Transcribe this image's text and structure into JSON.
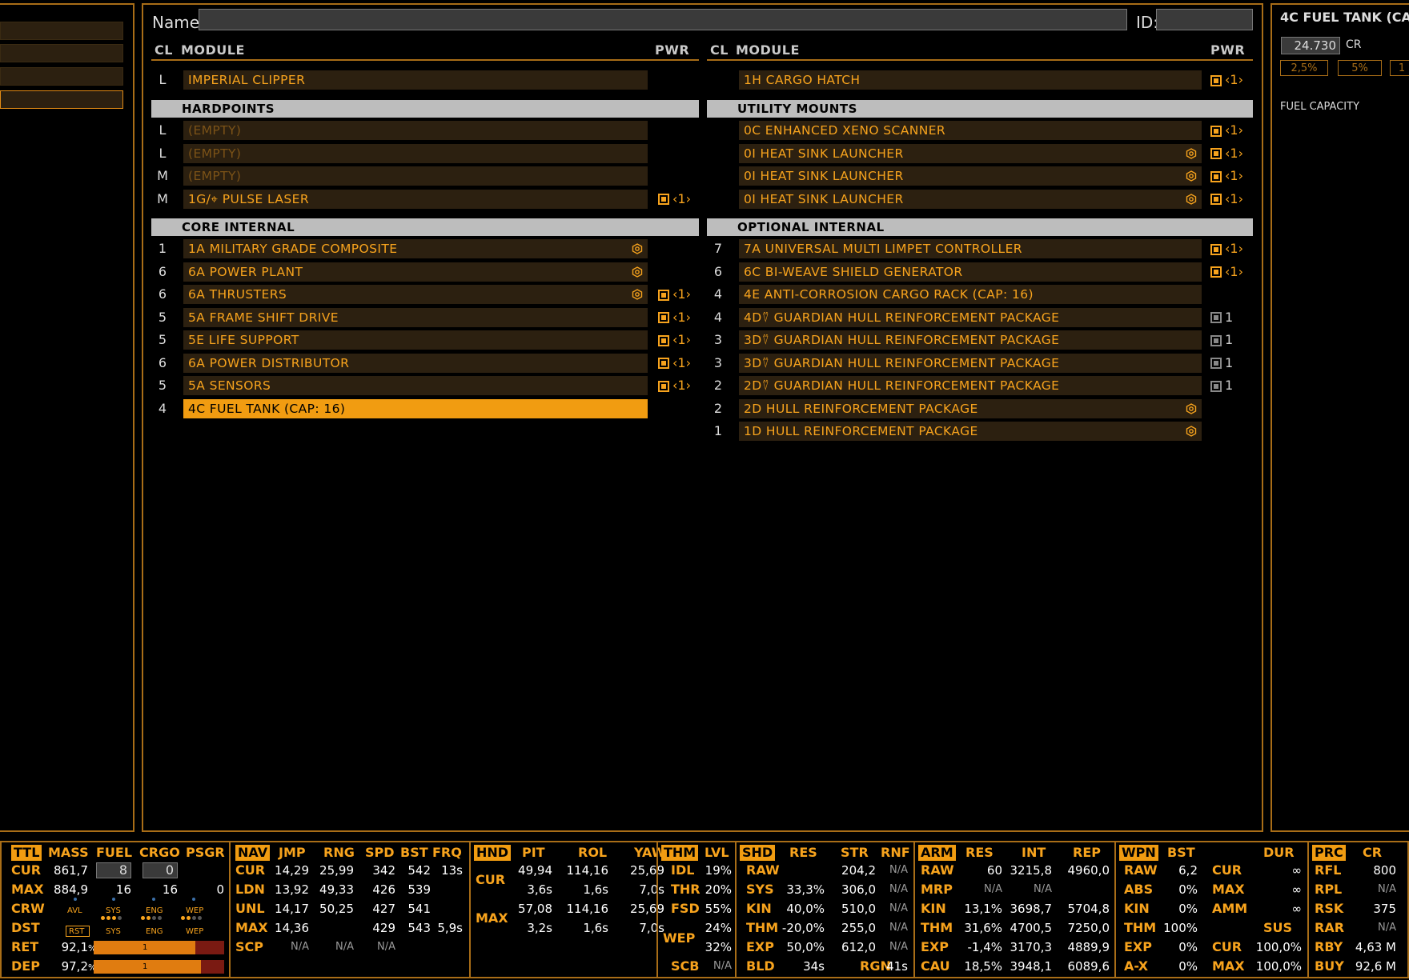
{
  "name_bar": {
    "name_label": "Name:",
    "name_value": "",
    "id_label": "ID:",
    "id_value": ""
  },
  "columns": {
    "cl": "CL",
    "module": "MODULE",
    "pwr": "PWR"
  },
  "left": {
    "hull": {
      "class": "L",
      "name": "IMPERIAL CLIPPER"
    },
    "hardpoints_title": "HARDPOINTS",
    "hardpoints": [
      {
        "class": "L",
        "name": "(EMPTY)",
        "empty": true
      },
      {
        "class": "L",
        "name": "(EMPTY)",
        "empty": true
      },
      {
        "class": "M",
        "name": "(EMPTY)",
        "empty": true
      },
      {
        "class": "M",
        "name": "1G/⌖ PULSE LASER",
        "pwr": true,
        "prio": "‹1›"
      }
    ],
    "core_title": "CORE INTERNAL",
    "core": [
      {
        "class": "1",
        "name": "1A MILITARY GRADE COMPOSITE",
        "eng": true
      },
      {
        "class": "6",
        "name": "6A POWER PLANT",
        "eng": true
      },
      {
        "class": "6",
        "name": "6A THRUSTERS",
        "eng": true,
        "pwr": true,
        "prio": "‹1›"
      },
      {
        "class": "5",
        "name": "5A FRAME SHIFT DRIVE",
        "pwr": true,
        "prio": "‹1›"
      },
      {
        "class": "5",
        "name": "5E LIFE SUPPORT",
        "pwr": true,
        "prio": "‹1›"
      },
      {
        "class": "6",
        "name": "6A POWER DISTRIBUTOR",
        "pwr": true,
        "prio": "‹1›"
      },
      {
        "class": "5",
        "name": "5A SENSORS",
        "pwr": true,
        "prio": "‹1›"
      },
      {
        "class": "4",
        "name": "4C FUEL TANK (CAP: 16)",
        "selected": true
      }
    ]
  },
  "right": {
    "cargo_hatch": {
      "name": "1H CARGO HATCH",
      "pwr": true,
      "prio": "‹1›"
    },
    "utility_title": "UTILITY MOUNTS",
    "utility": [
      {
        "name": "0C ENHANCED XENO SCANNER",
        "pwr": true,
        "prio": "‹1›"
      },
      {
        "name": "0I HEAT SINK LAUNCHER",
        "eng": true,
        "pwr": true,
        "prio": "‹1›"
      },
      {
        "name": "0I HEAT SINK LAUNCHER",
        "eng": true,
        "pwr": true,
        "prio": "‹1›"
      },
      {
        "name": "0I HEAT SINK LAUNCHER",
        "eng": true,
        "pwr": true,
        "prio": "‹1›"
      }
    ],
    "optional_title": "OPTIONAL INTERNAL",
    "optional": [
      {
        "class": "7",
        "name": "7A UNIVERSAL MULTI LIMPET CONTROLLER",
        "pwr": true,
        "prio": "‹1›"
      },
      {
        "class": "6",
        "name": "6C BI-WEAVE SHIELD GENERATOR",
        "pwr": true,
        "prio": "‹1›"
      },
      {
        "class": "4",
        "name": "4E ANTI-CORROSION CARGO RACK (CAP: 16)"
      },
      {
        "class": "4",
        "name": "4D⍢ GUARDIAN HULL REINFORCEMENT PACKAGE",
        "pwr_off": true,
        "prio": "1"
      },
      {
        "class": "3",
        "name": "3D⍢ GUARDIAN HULL REINFORCEMENT PACKAGE",
        "pwr_off": true,
        "prio": "1"
      },
      {
        "class": "3",
        "name": "3D⍢ GUARDIAN HULL REINFORCEMENT PACKAGE",
        "pwr_off": true,
        "prio": "1"
      },
      {
        "class": "2",
        "name": "2D⍢ GUARDIAN HULL REINFORCEMENT PACKAGE",
        "pwr_off": true,
        "prio": "1"
      },
      {
        "class": "2",
        "name": "2D HULL REINFORCEMENT PACKAGE",
        "eng": true
      },
      {
        "class": "1",
        "name": "1D HULL REINFORCEMENT PACKAGE",
        "eng": true
      }
    ]
  },
  "side_panel": {
    "title": "4C FUEL TANK (CA",
    "cost": "24.730",
    "cost_unit": "CR",
    "discounts": [
      "2,5%",
      "5%",
      "1"
    ],
    "fuel_capacity_label": "FUEL CAPACITY"
  },
  "stats": {
    "ttl": {
      "headers": [
        "TTL",
        "MASS",
        "FUEL",
        "CRGO",
        "PSGR"
      ],
      "cur": {
        "label": "CUR",
        "mass": "861,7",
        "fuel": "8",
        "crgo": "0"
      },
      "max": {
        "label": "MAX",
        "mass": "884,9",
        "fuel": "16",
        "crgo": "16",
        "psgr": "0"
      },
      "crw": "CRW",
      "dst": "DST",
      "ret": "RET",
      "dep": "DEP",
      "ret_val": "92,1",
      "dep_val": "97,2",
      "pct": "%",
      "avl": "AVL",
      "sys": "SYS",
      "eng": "ENG",
      "wep": "WEP",
      "rst": "RST",
      "ret_fill": 0.921,
      "dep_fill": 0.972,
      "bar_mark": "1"
    },
    "nav": {
      "headers": [
        "NAV",
        "JMP",
        "RNG",
        "SPD",
        "BST",
        "FRQ"
      ],
      "rows": [
        [
          "CUR",
          "14,29",
          "25,99",
          "342",
          "542",
          "13s"
        ],
        [
          "LDN",
          "13,92",
          "49,33",
          "426",
          "539",
          ""
        ],
        [
          "UNL",
          "14,17",
          "50,25",
          "427",
          "541",
          ""
        ],
        [
          "MAX",
          "14,36",
          "",
          "429",
          "543",
          "5,9s"
        ],
        [
          "SCP",
          "N/A",
          "N/A",
          "N/A",
          "",
          ""
        ]
      ]
    },
    "hnd": {
      "headers": [
        "HND",
        "PIT",
        "ROL",
        "YAW"
      ],
      "cur_label": "CUR",
      "max_label": "MAX",
      "rows": [
        [
          "49,94",
          "114,16",
          "25,69"
        ],
        [
          "3,6s",
          "1,6s",
          "7,0s"
        ],
        [
          "57,08",
          "114,16",
          "25,69"
        ],
        [
          "3,2s",
          "1,6s",
          "7,0s"
        ]
      ]
    },
    "thm": {
      "headers": [
        "THM",
        "LVL"
      ],
      "rows": [
        [
          "IDL",
          "19%"
        ],
        [
          "THR",
          "20%"
        ],
        [
          "FSD",
          "55%"
        ],
        [
          "WEP",
          "24%"
        ],
        [
          "",
          "32%"
        ],
        [
          "SCB",
          "N/A"
        ]
      ]
    },
    "shd": {
      "headers": [
        "SHD",
        "RES",
        "STR",
        "RNF"
      ],
      "rows": [
        [
          "RAW",
          "",
          "204,2",
          "N/A"
        ],
        [
          "SYS",
          "33,3%",
          "306,0",
          "N/A"
        ],
        [
          "KIN",
          "40,0%",
          "510,0",
          "N/A"
        ],
        [
          "THM",
          "-20,0%",
          "255,0",
          "N/A"
        ],
        [
          "EXP",
          "50,0%",
          "612,0",
          "N/A"
        ],
        [
          "BLD",
          "34s",
          "RGN",
          "41s"
        ]
      ]
    },
    "arm": {
      "headers": [
        "ARM",
        "RES",
        "INT",
        "REP"
      ],
      "rows": [
        [
          "RAW",
          "60",
          "3215,8",
          "4960,0"
        ],
        [
          "MRP",
          "N/A",
          "N/A",
          ""
        ],
        [
          "KIN",
          "13,1%",
          "3698,7",
          "5704,8"
        ],
        [
          "THM",
          "31,6%",
          "4700,5",
          "7250,0"
        ],
        [
          "EXP",
          "-1,4%",
          "3170,3",
          "4889,9"
        ],
        [
          "CAU",
          "18,5%",
          "3948,1",
          "6089,6"
        ]
      ]
    },
    "wpn": {
      "headers": [
        "WPN",
        "BST",
        "DUR"
      ],
      "rows": [
        [
          "RAW",
          "6,2",
          "CUR",
          "∞"
        ],
        [
          "ABS",
          "0%",
          "MAX",
          "∞"
        ],
        [
          "KIN",
          "0%",
          "AMM",
          "∞"
        ],
        [
          "THM",
          "100%",
          "SUS",
          ""
        ],
        [
          "EXP",
          "0%",
          "CUR",
          "100,0%"
        ],
        [
          "A-X",
          "0%",
          "MAX",
          "100,0%"
        ]
      ]
    },
    "prc": {
      "headers": [
        "PRC",
        "CR"
      ],
      "rows": [
        [
          "RFL",
          "800"
        ],
        [
          "RPL",
          "N/A"
        ],
        [
          "RSK",
          "375"
        ],
        [
          "RAR",
          "N/A"
        ],
        [
          "RBY",
          "4,63 M"
        ],
        [
          "BUY",
          "92,6 M"
        ]
      ]
    }
  }
}
